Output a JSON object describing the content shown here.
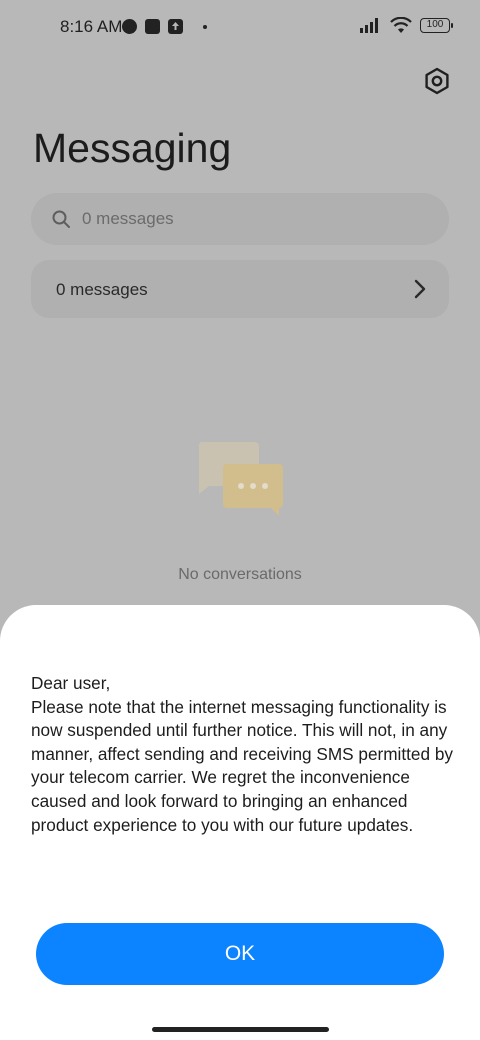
{
  "status_bar": {
    "time": "8:16 AM",
    "battery": "100",
    "icons": [
      "app-status-icon",
      "square-notification-icon",
      "upload-notification-icon",
      "signal-icon",
      "wifi-icon",
      "battery-icon"
    ]
  },
  "header": {
    "title": "Messaging",
    "settings_icon": "settings-icon"
  },
  "search": {
    "placeholder": "0 messages"
  },
  "messages_row": {
    "label": "0 messages"
  },
  "empty_state": {
    "text": "No conversations"
  },
  "dialog": {
    "greeting": "Dear user,",
    "body": "Please note that the internet messaging functionality is now suspended until further notice. This will not, in any manner, affect sending and receiving SMS permitted by your telecom carrier. We regret the inconvenience caused and look forward to bringing an enhanced product experience to you with our future updates.",
    "ok_label": "OK"
  },
  "colors": {
    "accent": "#0d84ff",
    "scrim": "#b8b8b8",
    "sheet": "#ffffff"
  }
}
